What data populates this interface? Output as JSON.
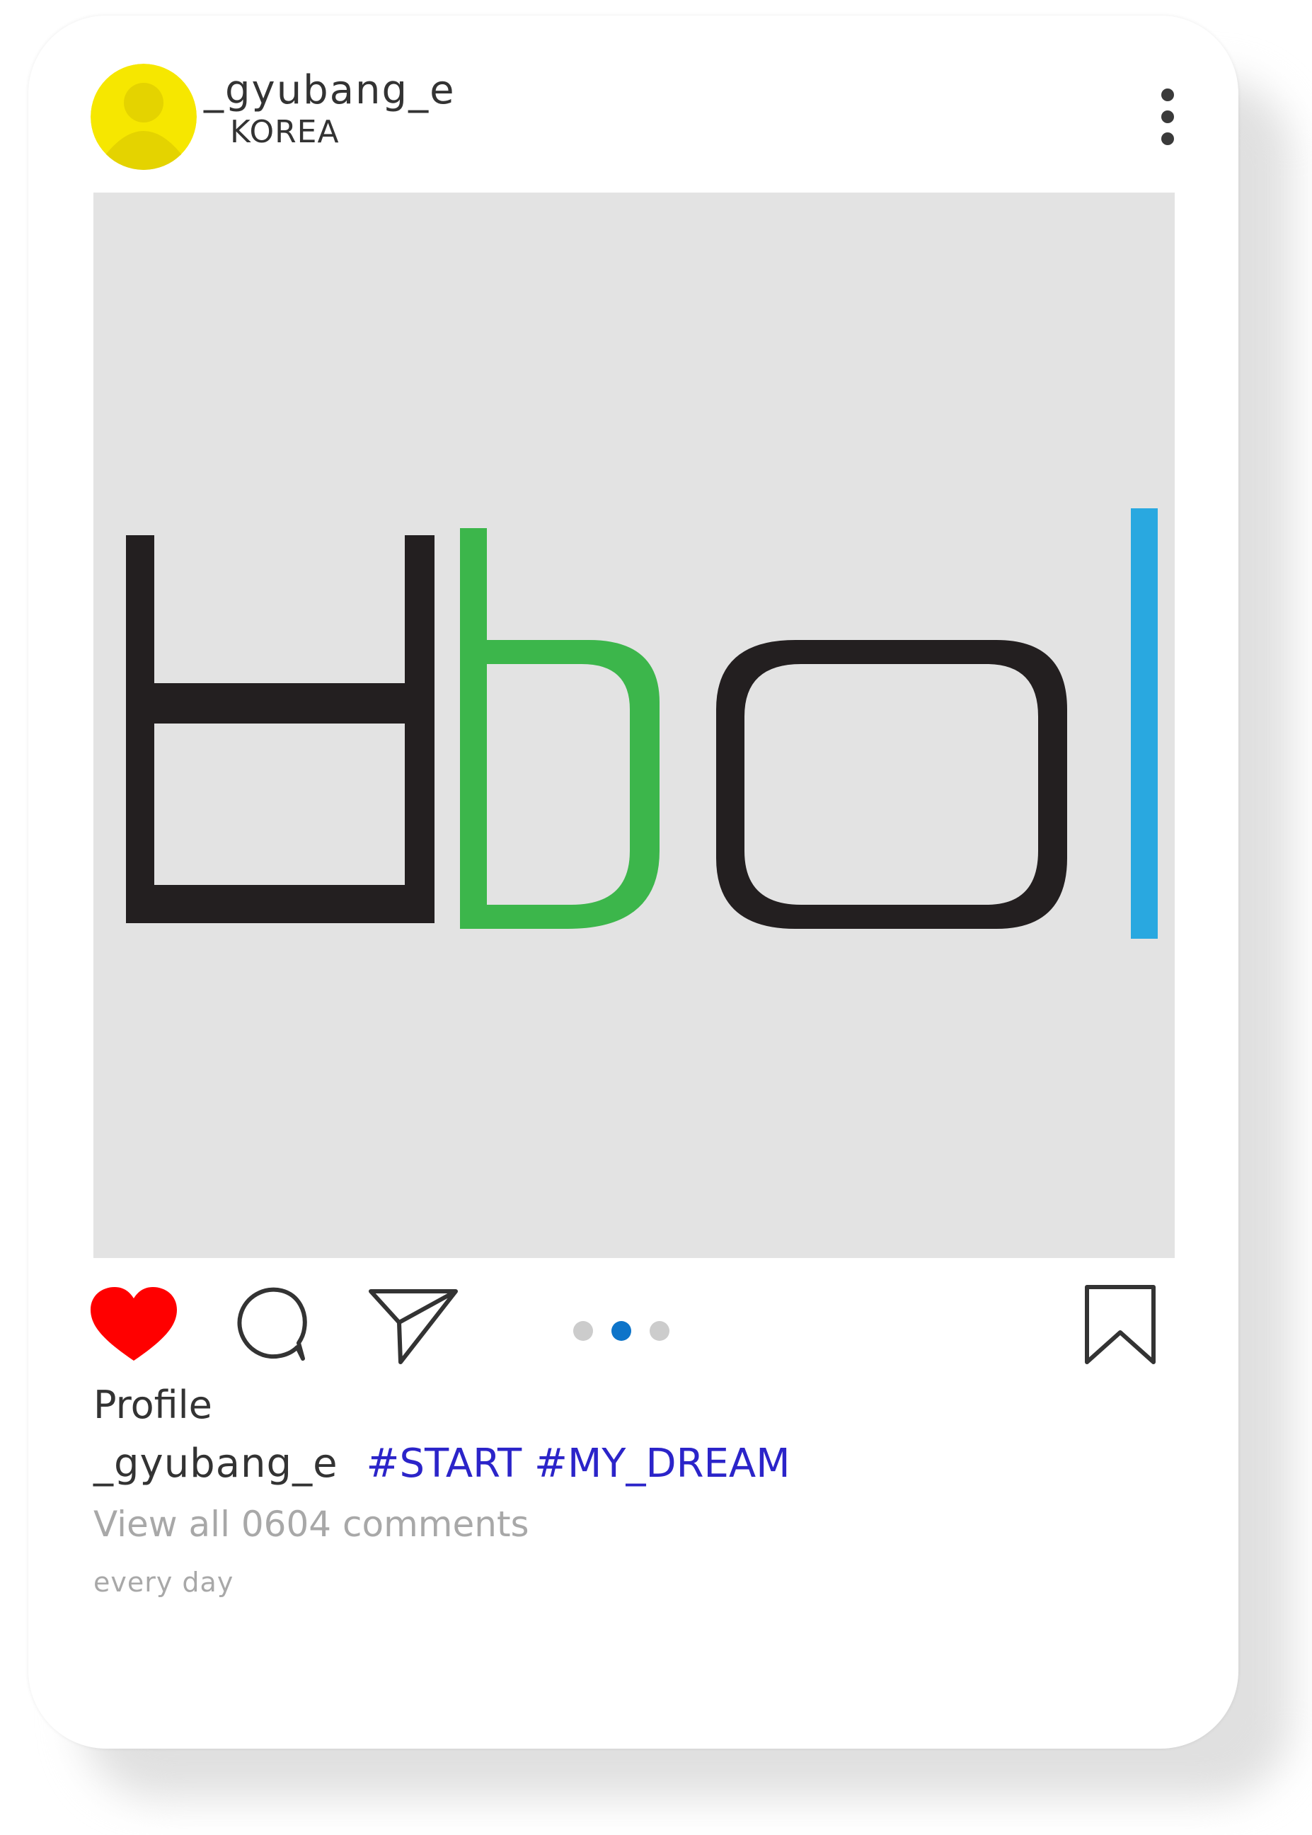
{
  "header": {
    "username": "_gyubang_e",
    "location": "KOREA",
    "avatar_icon": "user-avatar-icon",
    "avatar_color": "#f2e600",
    "more_icon": "more-vertical-icon"
  },
  "post": {
    "image_description_icon": "letter-logo-image",
    "image_bg": "#e3e3e3",
    "carousel": {
      "count": 3,
      "active_index": 1,
      "active_color": "#0d74c9"
    }
  },
  "actions": {
    "like_icon": "heart-icon",
    "like_color": "#ff0000",
    "comment_icon": "comment-bubble-icon",
    "share_icon": "paper-plane-icon",
    "save_icon": "bookmark-icon"
  },
  "footer": {
    "likes_label": "Profile",
    "caption_user": "_gyubang_e",
    "caption_tags": "#START #MY_DREAM",
    "view_comments": "View all 0604 comments",
    "timestamp": "every day",
    "tag_color": "#2b24c9"
  }
}
